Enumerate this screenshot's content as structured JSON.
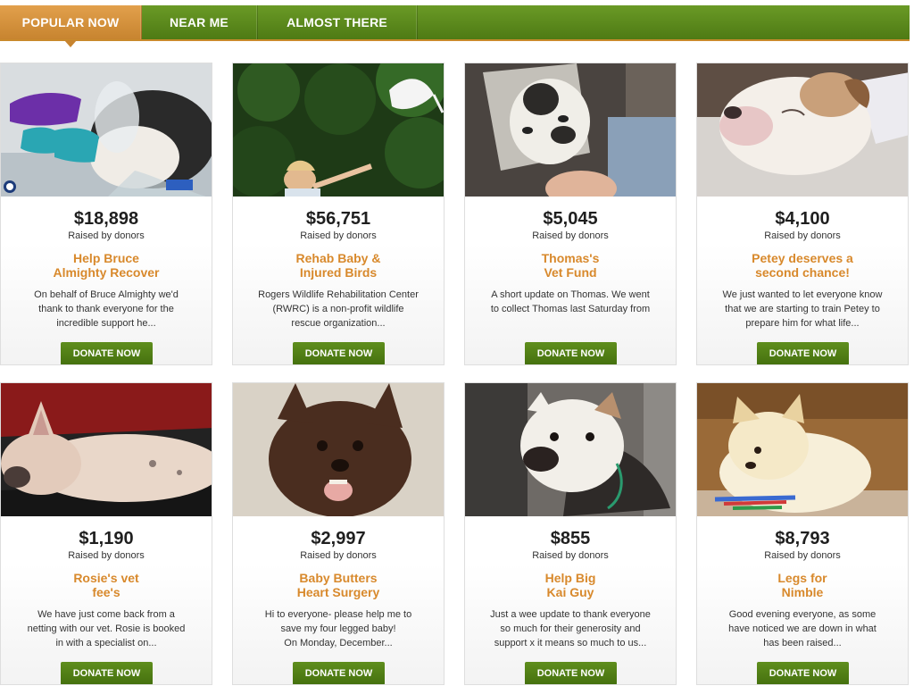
{
  "tabs": [
    {
      "label": "POPULAR NOW",
      "active": true
    },
    {
      "label": "NEAR ME",
      "active": false
    },
    {
      "label": "ALMOST THERE",
      "active": false
    }
  ],
  "raised_label": "Raised by donors",
  "donate_label": "DONATE NOW",
  "cards": [
    {
      "amount": "$18,898",
      "title_1": "Help Bruce",
      "title_2": "Almighty Recover",
      "desc_1": "On behalf of Bruce Almighty we'd",
      "desc_2": "thank to thank everyone for the",
      "desc_3": "incredible support he...",
      "photo": "cat-in-cone-with-bandages",
      "photo_logo": "Regina Humane Society"
    },
    {
      "amount": "$56,751",
      "title_1": "Rehab Baby &",
      "title_2": "Injured Birds",
      "desc_1": "Rogers Wildlife Rehabilitation Center",
      "desc_2": "(RWRC) is a non-profit wildlife",
      "desc_3": "rescue organization...",
      "photo": "woman-releasing-egret"
    },
    {
      "amount": "$5,045",
      "title_1": "Thomas's",
      "title_2": "Vet Fund",
      "desc_1": "A short update on Thomas. We went",
      "desc_2": "to collect Thomas last Saturday from",
      "desc_3": "",
      "photo": "cat-in-cone"
    },
    {
      "amount": "$4,100",
      "title_1": "Petey deserves a",
      "title_2": "second chance!",
      "desc_1": "We just wanted to let everyone know",
      "desc_2": "that we are starting to train Petey to",
      "desc_3": "prepare him for what life...",
      "photo": "sleeping-bulldog"
    },
    {
      "amount": "$1,190",
      "title_1": "Rosie's vet",
      "title_2": "fee's",
      "desc_1": "We have just come back from a",
      "desc_2": "netting with our vet. Rosie is booked",
      "desc_3": "in with a specialist on...",
      "photo": "french-bulldog-lying"
    },
    {
      "amount": "$2,997",
      "title_1": "Baby Butters",
      "title_2": "Heart Surgery",
      "desc_1": "Hi to everyone- please help me to",
      "desc_2": "save my four legged baby!",
      "desc_3": "On Monday, December...",
      "photo": "small-brown-dog"
    },
    {
      "amount": "$855",
      "title_1": "Help Big",
      "title_2": "Kai Guy",
      "desc_1": "Just a wee update to thank everyone",
      "desc_2": "so much for their generosity and",
      "desc_3": "support x it means so much to us...",
      "photo": "bulldog-in-hoodie"
    },
    {
      "amount": "$8,793",
      "title_1": "Legs for",
      "title_2": "Nimble",
      "desc_1": "Good evening everyone, as some",
      "desc_2": "have noticed we are down in what",
      "desc_3": "has been raised...",
      "photo": "puppy-with-toy"
    }
  ]
}
